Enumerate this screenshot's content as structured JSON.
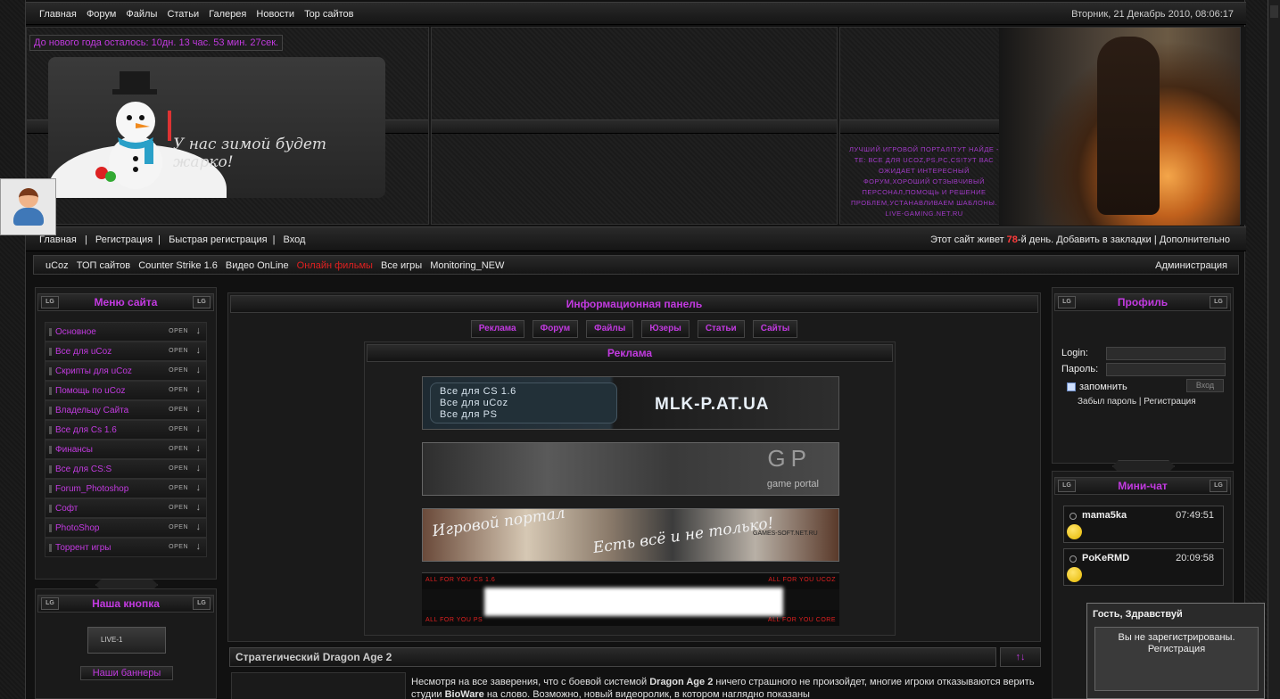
{
  "topnav": {
    "links": [
      "Главная",
      "Форум",
      "Файлы",
      "Статьи",
      "Галерея",
      "Новости",
      "Top сайтов"
    ],
    "datetime": "Вторник, 21 Декабрь 2010, 08:06:17"
  },
  "header": {
    "countdown": "До нового года осталось: 10дн. 13 час. 53 мин. 27сек.",
    "motto": "У нас зимой будет жарко!",
    "promo": "лучший игровой портал!тут найде - те: все для ucoz,ps,pc,cs!тут вас ожидает интересный форум,хороший отзывчивый персонал,помощь и решение проблем,устанавливаем шаблоны. live-gaming.net.ru"
  },
  "usernav": {
    "links": [
      "Главная",
      "Регистрация",
      "Быстрая регистрация",
      "Вход"
    ],
    "alive_prefix": "Этот сайт живет ",
    "alive_days": "78",
    "alive_suffix": "-й день.",
    "bookmark": "Добавить в закладки",
    "more": "Дополнительно"
  },
  "linkbar": {
    "links": [
      "uCoz",
      "ТОП сайтов",
      "Counter Strike 1.6",
      "Видео OnLine"
    ],
    "hot": "Онлайн фильмы",
    "links2": [
      "Все игры",
      "Monitoring_NEW"
    ],
    "admin": "Администрация"
  },
  "lg": "LG",
  "sitemenu": {
    "title": "Меню сайта",
    "open": "OPEN",
    "arrow": "↓",
    "items": [
      "Основное",
      "Все для uCoz",
      "Скрипты для uCoz",
      "Помощь по uCoz",
      "Владельцу Сайта",
      "Все для Cs 1.6",
      "Финансы",
      "Все для CS:S",
      "Forum_Photoshop",
      "Софт",
      "PhotoShop",
      "Торрент игры"
    ]
  },
  "ourbutton": {
    "title": "Наша кнопка",
    "btn_text": "LIVE-1",
    "banners": "Наши баннеры"
  },
  "infopanel": {
    "title": "Информационная панель",
    "tabs": [
      "Реклама",
      "Форум",
      "Файлы",
      "Юзеры",
      "Статьи",
      "Сайты"
    ],
    "ads_title": "Реклама",
    "ad1_lines": [
      "Все для CS 1.6",
      "Все для uCoz",
      "Все для PS"
    ],
    "ad1_site": "MLK-P.AT.UA",
    "ad2_logo": "GP",
    "ad2_text": "game portal",
    "ad3_left": "Игровой портал",
    "ad3_mid": "Есть всё и не только!",
    "ad3_site": "GAMES-SOFT.NET.RU",
    "ad4_tl": "ALL FOR YOU CS 1.6",
    "ad4_tr": "ALL FOR YOU UCOZ",
    "ad4_bl": "ALL FOR YOU PS",
    "ad4_br": "ALL FOR YOU CORE"
  },
  "article": {
    "title": "Стратегический Dragon Age 2",
    "toggle": "↑↓",
    "text_a": "Несмотря на все заверения, что с боевой системой ",
    "text_b": "Dragon Age 2",
    "text_c": " ничего страшного не произойдет, многие игроки отказываются верить студии ",
    "text_d": "BioWare",
    "text_e": " на слово. Возможно, новый видеоролик, в котором наглядно показаны"
  },
  "profile": {
    "title": "Профиль",
    "login_label": "Login:",
    "password_label": "Пароль:",
    "remember": "запомнить",
    "submit": "Вход",
    "forgot": "Забыл пароль | Регистрация"
  },
  "minichat": {
    "title": "Мини-чат",
    "messages": [
      {
        "name": "mama5ka",
        "time": "07:49:51"
      },
      {
        "name": "PoKeRMD",
        "time": "20:09:58"
      }
    ]
  },
  "popup": {
    "title": "Гость, Здравствуй",
    "line1": "Вы не зарегистрированы.",
    "line2": "Регистрация"
  },
  "colors": {
    "accent": "#c23ae0",
    "hot": "#e02020",
    "alive": "#ff3b3b"
  }
}
